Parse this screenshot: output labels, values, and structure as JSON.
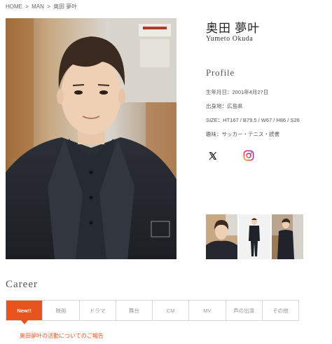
{
  "breadcrumb": {
    "home": "HOME",
    "sep1": ">",
    "man": "MAN",
    "sep2": ">",
    "current": "奥田 夢叶"
  },
  "profile": {
    "name_ja": "奥田 夢叶",
    "name_en": "Yumeto Okuda",
    "heading": "Profile",
    "birthday": "生年月日：2001年4月27日",
    "birthplace": "出身地：広島県",
    "size": "SIZE：HT167 / B79.5 / W67 / H86 / S26",
    "hobby": "趣味：サッカー・テニス・読書"
  },
  "social": {
    "x_icon": "x-logo-icon",
    "instagram_icon": "instagram-icon"
  },
  "career": {
    "heading": "Career",
    "tabs": [
      "New!!",
      "映画",
      "ドラマ",
      "舞台",
      "CM",
      "MV",
      "声の出演",
      "その他"
    ],
    "active_tab": 0,
    "news_link": "奥田夢叶の活動についてのご報告"
  },
  "colors": {
    "accent": "#e8541e"
  }
}
